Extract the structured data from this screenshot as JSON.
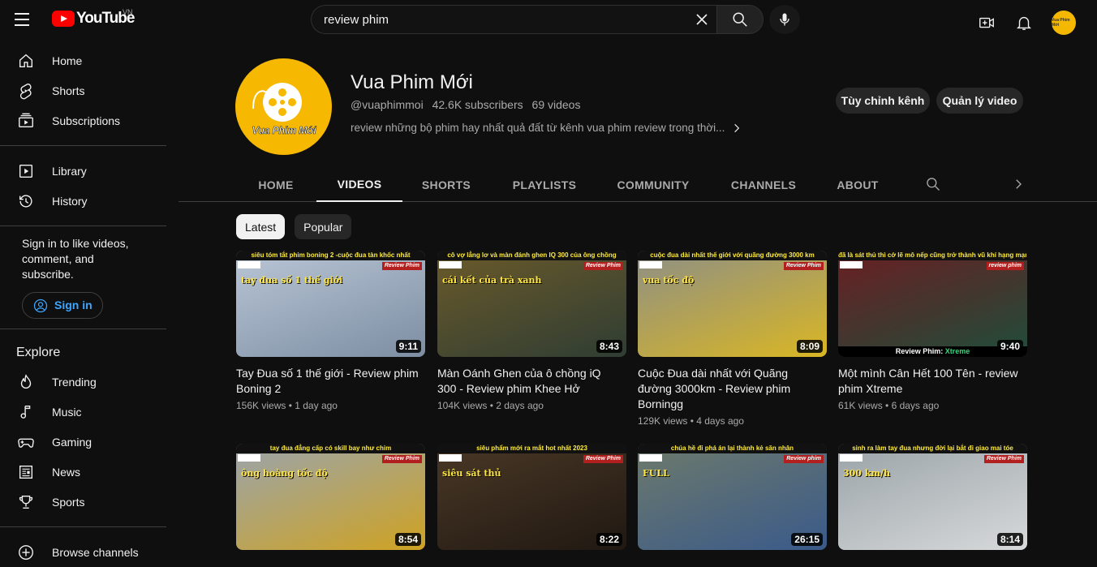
{
  "header": {
    "logo_text": "YouTube",
    "logo_region": "VN",
    "search_value": "review phim",
    "search_placeholder": "Search"
  },
  "sidebar": {
    "main": [
      {
        "label": "Home",
        "icon": "home-icon"
      },
      {
        "label": "Shorts",
        "icon": "shorts-icon"
      },
      {
        "label": "Subscriptions",
        "icon": "subscriptions-icon"
      }
    ],
    "library": [
      {
        "label": "Library",
        "icon": "library-icon"
      },
      {
        "label": "History",
        "icon": "history-icon"
      }
    ],
    "signin_text": "Sign in to like videos, comment, and subscribe.",
    "signin_button": "Sign in",
    "explore_title": "Explore",
    "explore": [
      {
        "label": "Trending",
        "icon": "trending-icon"
      },
      {
        "label": "Music",
        "icon": "music-icon"
      },
      {
        "label": "Gaming",
        "icon": "gaming-icon"
      },
      {
        "label": "News",
        "icon": "news-icon"
      },
      {
        "label": "Sports",
        "icon": "sports-icon"
      }
    ],
    "browse_label": "Browse channels"
  },
  "channel": {
    "avatar_text": "Vua Phim Mới",
    "name": "Vua Phim Mới",
    "handle": "@vuaphimmoi",
    "subscribers": "42.6K subscribers",
    "videos": "69 videos",
    "description": "review những bộ phim hay nhất quả đất từ kênh vua phim review trong thời...",
    "customize_button": "Tùy chỉnh kênh",
    "manage_button": "Quản lý video"
  },
  "tabs": [
    "HOME",
    "VIDEOS",
    "SHORTS",
    "PLAYLISTS",
    "COMMUNITY",
    "CHANNELS",
    "ABOUT"
  ],
  "active_tab": "VIDEOS",
  "chips": [
    "Latest",
    "Popular"
  ],
  "videos": [
    {
      "banner": "siêu tóm tắt phim boning 2 -cuộc đua tàn khốc nhất",
      "badge": "Review Phim",
      "overlay": "tay đua số 1 thế giới",
      "duration": "9:11",
      "title": "Tay Đua số 1 thế giới - Review phim Boning 2",
      "views": "156K views",
      "age": "1 day ago",
      "colors": [
        "#b9c6d6",
        "#7d8ea3"
      ]
    },
    {
      "banner": "cô vợ lẳng lơ và màn đánh ghen IQ 300 của ông chồng",
      "badge": "Review Phim",
      "overlay": "cái kết của trà xanh",
      "duration": "8:43",
      "title": "Màn Oánh Ghen của ô chồng iQ 300 - Review phim Khee Hở",
      "views": "104K views",
      "age": "2 days ago",
      "colors": [
        "#6b5a2a",
        "#2f3d33"
      ]
    },
    {
      "banner": "cuộc đua dài nhất thế giới với quãng đường 3000 km",
      "badge": "Review Phim",
      "overlay": "vua tốc độ",
      "duration": "8:09",
      "title": "Cuộc Đua dài nhất với Quãng đường 3000km - Review phim Borningg",
      "views": "129K views",
      "age": "4 days ago",
      "colors": [
        "#8d8f86",
        "#d9b624"
      ]
    },
    {
      "banner": "đã là sát thủ thì cớ lẽ mô nếp cũng trở thành vũ khí hạng mạnh",
      "badge": "review phim",
      "overlay": "",
      "duration": "9:40",
      "title": "Một mình Cân Hết 100 Tên - review phim Xtreme",
      "views": "61K views",
      "age": "6 days ago",
      "caption": "Review Phim:",
      "caption_em": "Xtreme",
      "colors": [
        "#6a1e22",
        "#1f4d3a"
      ]
    },
    {
      "banner": "tay đua đẳng cấp có skill bay như chim",
      "badge": "Review Phim",
      "overlay": "ông hoàng tốc độ",
      "duration": "8:54",
      "title": "",
      "views": "",
      "age": "",
      "colors": [
        "#9aa4ad",
        "#cfa322"
      ]
    },
    {
      "banner": "siêu phẩm mới ra mắt hot nhất 2023",
      "badge": "Review Phim",
      "overlay": "siêu sát thủ",
      "duration": "8:22",
      "title": "",
      "views": "",
      "age": "",
      "colors": [
        "#4a3826",
        "#201812"
      ]
    },
    {
      "banner": "chúa hề đi phá án lại thành kẻ săn nhân",
      "badge": "Review phim",
      "overlay": "FULL",
      "duration": "26:15",
      "title": "",
      "views": "",
      "age": "",
      "colors": [
        "#6d7a6b",
        "#3a5a8a"
      ]
    },
    {
      "banner": "sinh ra làm tay đua nhưng đời lại bắt đi giao mai tóe",
      "badge": "Review Phim",
      "overlay": "300 km/h",
      "duration": "8:14",
      "title": "",
      "views": "",
      "age": "",
      "colors": [
        "#9aa3a8",
        "#d7d9da"
      ]
    }
  ]
}
